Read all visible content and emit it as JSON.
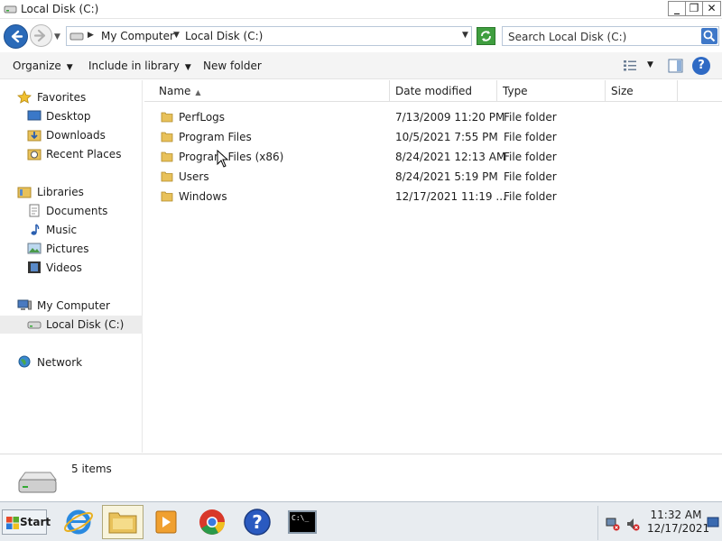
{
  "window": {
    "title": "Local Disk (C:)",
    "buttons": {
      "minimize": "_",
      "maximize": "❐",
      "close": "✕"
    }
  },
  "address": {
    "crumbs": [
      "My Computer",
      "Local Disk (C:)"
    ],
    "search_placeholder": "Search Local Disk (C:)"
  },
  "toolbar": {
    "organize": "Organize",
    "include_in_library": "Include in library",
    "new_folder": "New folder",
    "help": "?"
  },
  "nav": {
    "favorites": "Favorites",
    "desktop": "Desktop",
    "downloads": "Downloads",
    "recent_places": "Recent Places",
    "libraries": "Libraries",
    "documents": "Documents",
    "music": "Music",
    "pictures": "Pictures",
    "videos": "Videos",
    "my_computer": "My Computer",
    "local_disk": "Local Disk (C:)",
    "network": "Network"
  },
  "columns": {
    "name": "Name",
    "date_modified": "Date modified",
    "type": "Type",
    "size": "Size"
  },
  "files": [
    {
      "name": "PerfLogs",
      "date": "7/13/2009 11:20 PM",
      "type": "File folder",
      "size": ""
    },
    {
      "name": "Program Files",
      "date": "10/5/2021 7:55 PM",
      "type": "File folder",
      "size": ""
    },
    {
      "name": "Program Files (x86)",
      "date": "8/24/2021 12:13 AM",
      "type": "File folder",
      "size": ""
    },
    {
      "name": "Users",
      "date": "8/24/2021 5:19 PM",
      "type": "File folder",
      "size": ""
    },
    {
      "name": "Windows",
      "date": "12/17/2021 11:19 ...",
      "type": "File folder",
      "size": ""
    }
  ],
  "details": {
    "item_count": "5 items"
  },
  "taskbar": {
    "start": "Start",
    "cmd_label": "C:\\_",
    "time": "11:32 AM",
    "date": "12/17/2021"
  },
  "colors": {
    "accent": "#2a6ab8",
    "folder": "#e8c15a",
    "taskbar": "#e8ecf0"
  }
}
